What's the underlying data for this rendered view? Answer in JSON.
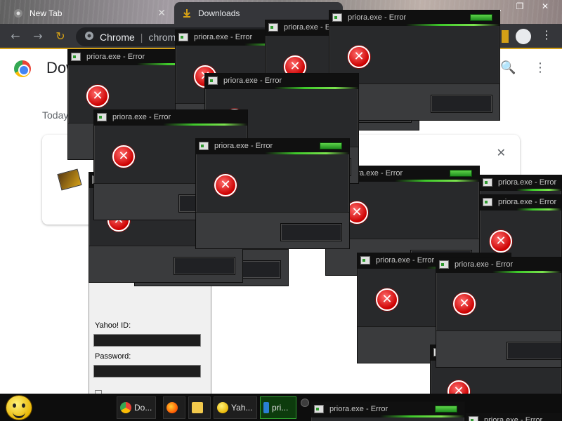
{
  "browser": {
    "tabs": [
      {
        "label": "New Tab",
        "icon": "chrome-icon",
        "active": false
      },
      {
        "label": "Downloads",
        "icon": "download-icon",
        "active": true
      }
    ],
    "omnibox": {
      "site": "Chrome",
      "url": "chrome://downloads"
    },
    "accent": "#d4a017"
  },
  "downloads_page": {
    "title": "Downloads",
    "date_group": "Today"
  },
  "yahoo": {
    "id_label": "Yahoo! ID:",
    "password_label": "Password:"
  },
  "error_dialog": {
    "title": "priora.exe - Error",
    "accent": "#3ec92a"
  },
  "taskbar": {
    "items": [
      {
        "label": "Do...",
        "icon": "chrome-icon"
      },
      {
        "label": "",
        "icon": "firefox-icon"
      },
      {
        "label": "",
        "icon": "folder-icon"
      },
      {
        "label": "Yah...",
        "icon": "yahoo-messenger-icon"
      },
      {
        "label": "pri...",
        "icon": "priora-icon",
        "active": true
      }
    ]
  }
}
